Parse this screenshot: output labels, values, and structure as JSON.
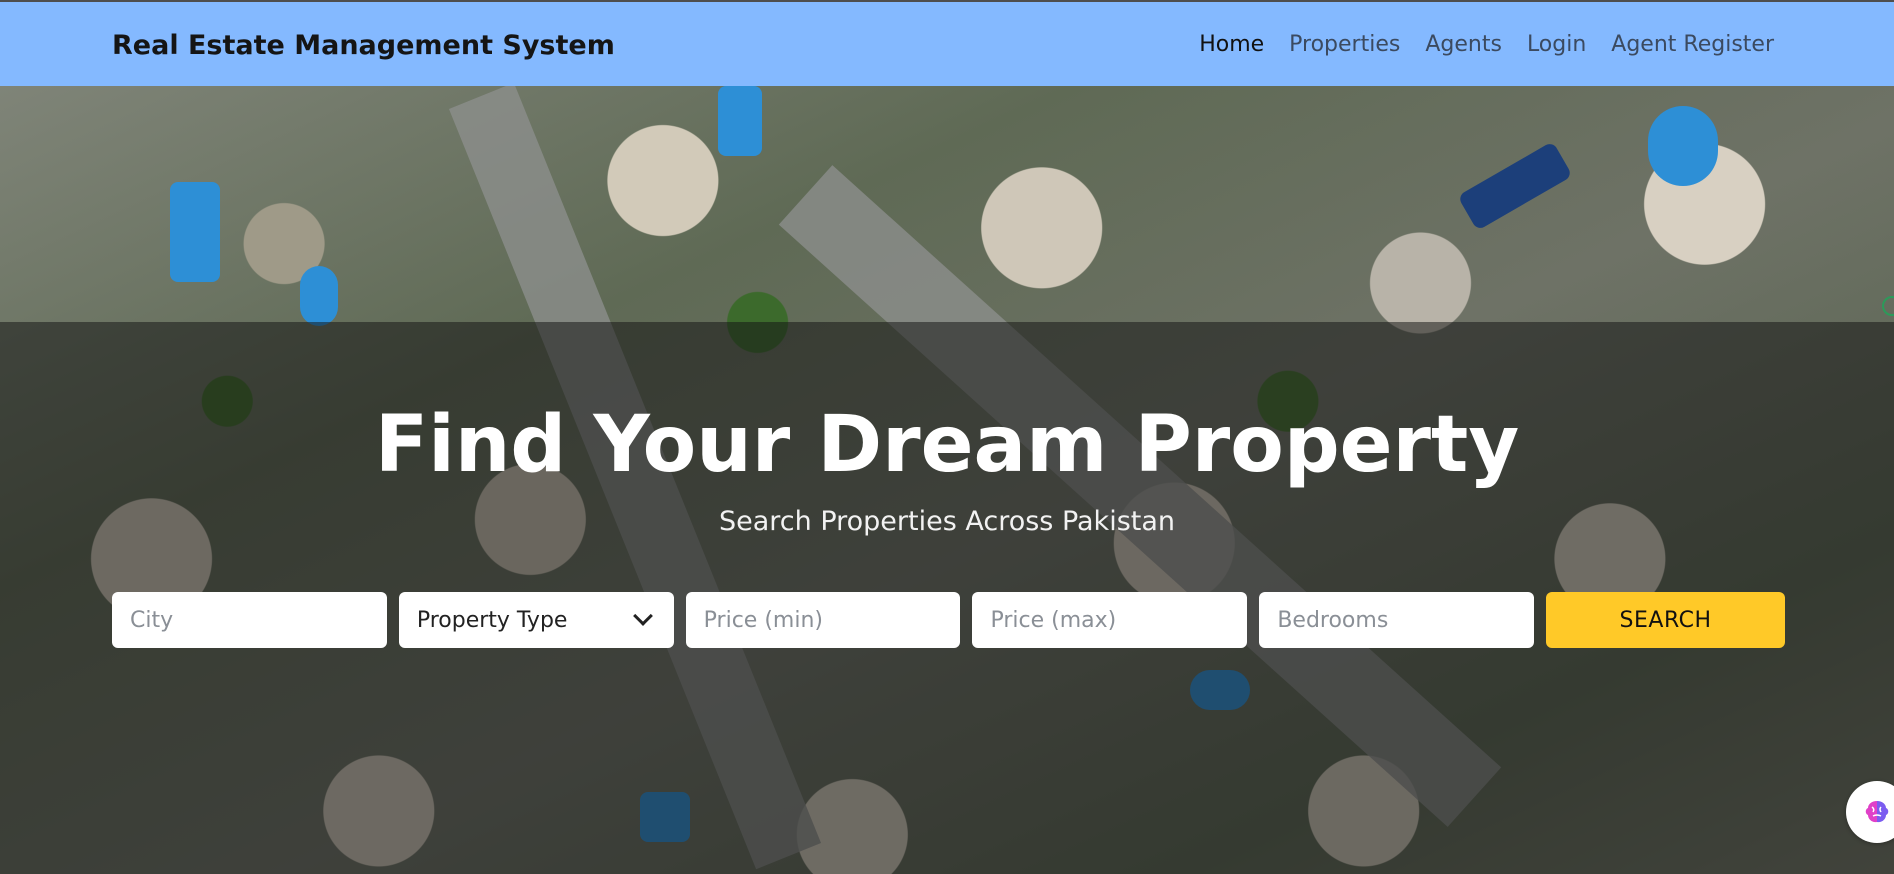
{
  "navbar": {
    "brand": "Real Estate Management System",
    "links": [
      {
        "label": "Home"
      },
      {
        "label": "Properties"
      },
      {
        "label": "Agents"
      },
      {
        "label": "Login"
      },
      {
        "label": "Agent Register"
      }
    ]
  },
  "hero": {
    "title": "Find Your Dream Property",
    "subtitle": "Search Properties Across Pakistan"
  },
  "search": {
    "city_placeholder": "City",
    "property_type_value": "Property Type",
    "price_min_placeholder": "Price (min)",
    "price_max_placeholder": "Price (max)",
    "bedrooms_placeholder": "Bedrooms",
    "button_label": "SEARCH"
  },
  "colors": {
    "navbar_bg": "#84b9ff",
    "search_button": "#ffc928"
  },
  "icons": {
    "dropdown": "chevron-down-icon",
    "assistant": "brain-icon"
  }
}
